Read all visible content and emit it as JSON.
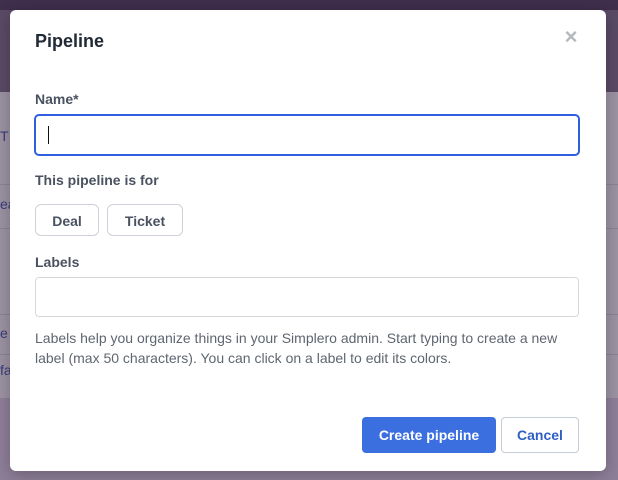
{
  "background": {
    "peek_texts": [
      "T",
      "ea",
      "e",
      "fa"
    ]
  },
  "modal": {
    "title": "Pipeline",
    "close_icon": "×",
    "name_label": "Name*",
    "name_value": "",
    "pipeline_for_label": "This pipeline is for",
    "pipeline_for_options": [
      "Deal",
      "Ticket"
    ],
    "labels_label": "Labels",
    "labels_value": "",
    "labels_help": "Labels help you organize things in your Simplero admin. Start typing to create a new label (max 50 characters). You can click on a label to edit its colors.",
    "create_button": "Create pipeline",
    "cancel_button": "Cancel"
  },
  "colors": {
    "primary": "#3b6fe0",
    "focus_border": "#2f5fe0",
    "backdrop": "#8e7f98"
  }
}
